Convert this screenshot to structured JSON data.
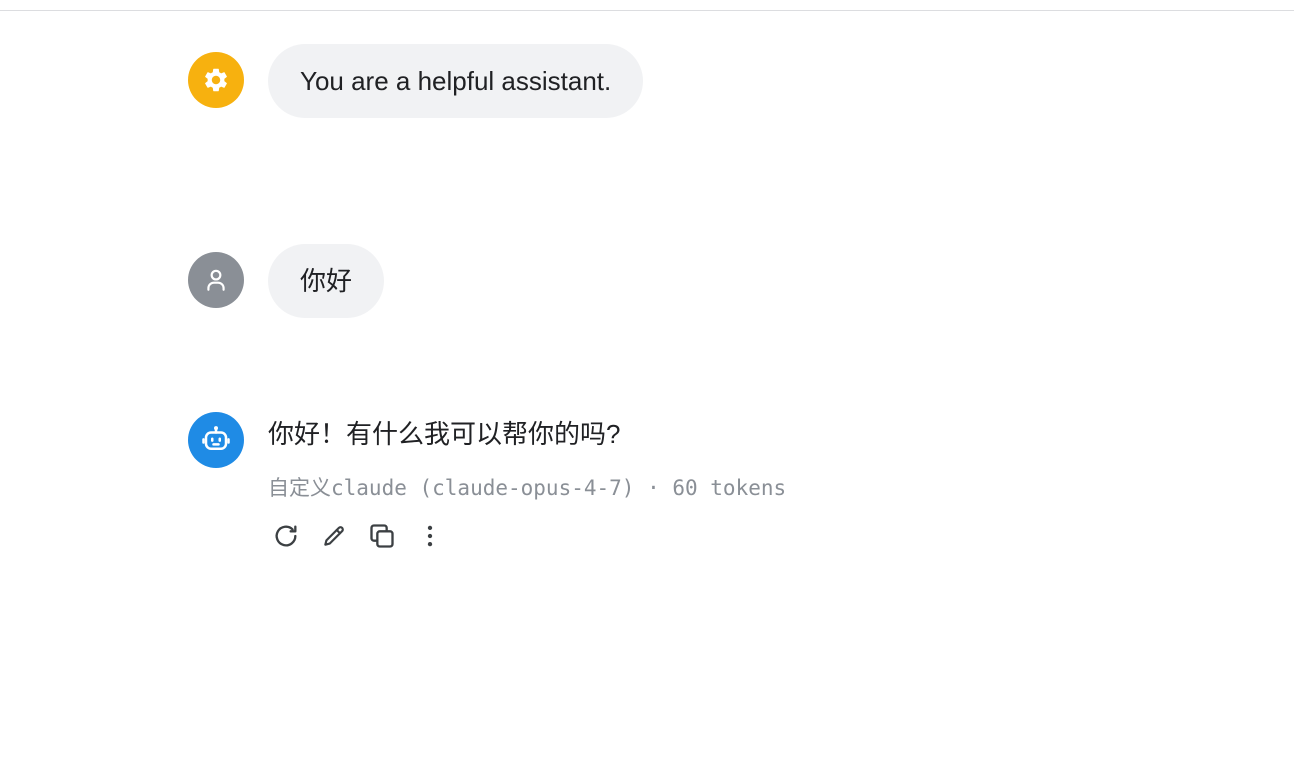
{
  "messages": {
    "system": {
      "avatar_icon": "gear-icon",
      "avatar_color": "#f7b10f",
      "text": "You are a helpful assistant."
    },
    "user": {
      "avatar_icon": "person-icon",
      "avatar_color": "#8a8f96",
      "text": "你好"
    },
    "assistant": {
      "avatar_icon": "robot-icon",
      "avatar_color": "#1f8be5",
      "text": "你好！有什么我可以帮你的吗?",
      "meta": "自定义claude (claude-opus-4-7) · 60 tokens",
      "actions": [
        {
          "icon": "refresh-icon",
          "label": "regenerate"
        },
        {
          "icon": "pencil-icon",
          "label": "edit"
        },
        {
          "icon": "copy-icon",
          "label": "copy"
        },
        {
          "icon": "more-vertical-icon",
          "label": "more"
        }
      ]
    }
  }
}
